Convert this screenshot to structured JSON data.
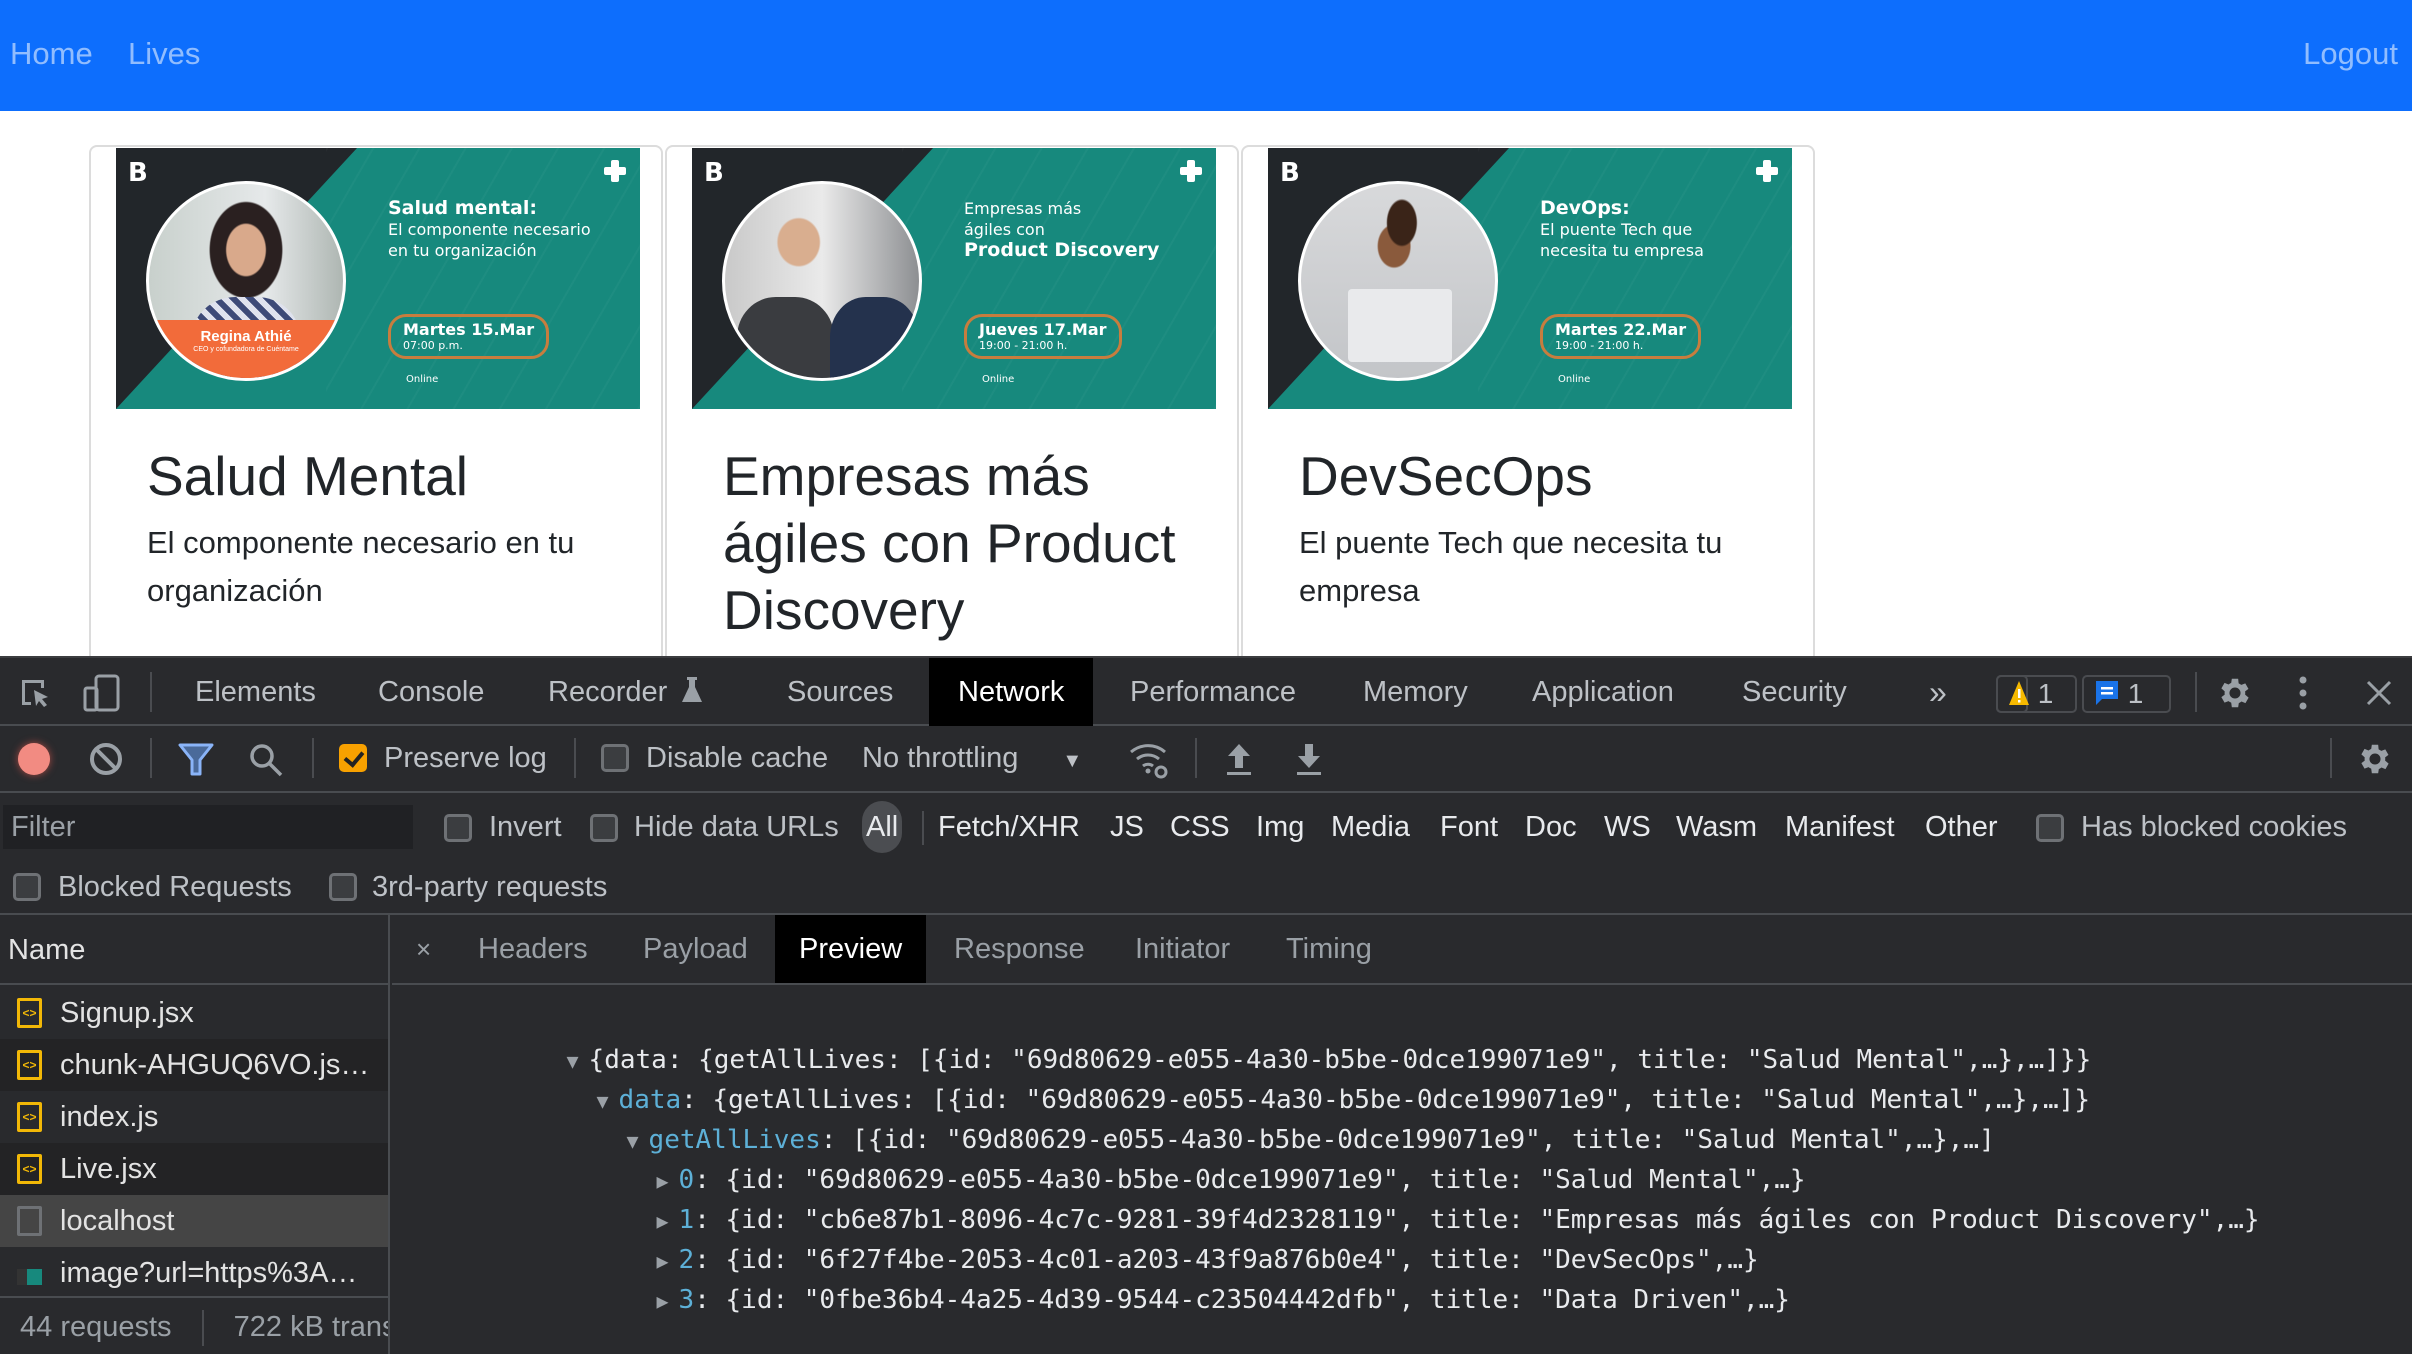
{
  "navbar": {
    "links": [
      "Home",
      "Lives"
    ],
    "logout": "Logout",
    "color": "#0d6efd"
  },
  "cards": [
    {
      "title": "Salud Mental",
      "description": "El componente necesario en tu organización",
      "image": {
        "headline_bold": "Salud mental:",
        "headline_rest": "El componente necesario en tu organización",
        "speaker_name": "Regina Athié",
        "speaker_role": "CEO y cofundadora de Cuéntame",
        "date": "Martes 15.Mar",
        "time": "07:00 p.m.",
        "mode": "Online"
      }
    },
    {
      "title": "Empresas más ágiles con Product Discovery",
      "description": "",
      "image": {
        "headline_pre": "Empresas más ágiles con",
        "headline_bold": "Product Discovery",
        "date": "Jueves 17.Mar",
        "time": "19:00 - 21:00 h.",
        "mode": "Online"
      }
    },
    {
      "title": "DevSecOps",
      "description": "El puente Tech que necesita tu empresa",
      "image": {
        "headline_bold": "DevOps:",
        "headline_rest": "El puente Tech que necesita tu empresa",
        "date": "Martes 22.Mar",
        "time": "19:00 - 21:00 h.",
        "mode": "Online"
      }
    }
  ],
  "devtools": {
    "tabs": [
      "Elements",
      "Console",
      "Recorder",
      "Sources",
      "Network",
      "Performance",
      "Memory",
      "Application",
      "Security"
    ],
    "active_tab": "Network",
    "more_tabs": "»",
    "warnings_count": "1",
    "messages_count": "1",
    "toolbar": {
      "preserve_log": {
        "label": "Preserve log",
        "checked": true
      },
      "disable_cache": {
        "label": "Disable cache",
        "checked": false
      },
      "throttling": "No throttling"
    },
    "filter": {
      "placeholder": "Filter",
      "invert": {
        "label": "Invert",
        "checked": false
      },
      "hide_data_urls": {
        "label": "Hide data URLs",
        "checked": false
      },
      "types": [
        "All",
        "Fetch/XHR",
        "JS",
        "CSS",
        "Img",
        "Media",
        "Font",
        "Doc",
        "WS",
        "Wasm",
        "Manifest",
        "Other"
      ],
      "active_type": "All",
      "has_blocked_cookies": {
        "label": "Has blocked cookies",
        "checked": false
      },
      "blocked_requests": {
        "label": "Blocked Requests",
        "checked": false
      },
      "third_party": {
        "label": "3rd-party requests",
        "checked": false
      }
    },
    "requests": {
      "header": "Name",
      "items": [
        {
          "name": "Signup.jsx",
          "type": "script"
        },
        {
          "name": "chunk-AHGUQ6VO.js…",
          "type": "script"
        },
        {
          "name": "index.js",
          "type": "script"
        },
        {
          "name": "Live.jsx",
          "type": "script"
        },
        {
          "name": "localhost",
          "type": "document",
          "selected": true
        },
        {
          "name": "image?url=https%3A…",
          "type": "image"
        }
      ],
      "summary_count": "44 requests",
      "summary_transfer": "722 kB trans"
    },
    "preview": {
      "close": "×",
      "tabs": [
        "Headers",
        "Payload",
        "Preview",
        "Response",
        "Initiator",
        "Timing"
      ],
      "active_tab": "Preview",
      "lines": [
        {
          "toggle": "▼",
          "key": "",
          "text": "{data: {getAllLives: [{id: \"69d80629-e055-4a30-b5be-0dce199071e9\", title: \"Salud Mental\",…},…]}}"
        },
        {
          "toggle": "▼",
          "key": "data",
          "text": ": {getAllLives: [{id: \"69d80629-e055-4a30-b5be-0dce199071e9\", title: \"Salud Mental\",…},…]}"
        },
        {
          "toggle": "▼",
          "key": "getAllLives",
          "text": ": [{id: \"69d80629-e055-4a30-b5be-0dce199071e9\", title: \"Salud Mental\",…},…]"
        },
        {
          "toggle": "▶",
          "key": "0",
          "text": ": {id: \"69d80629-e055-4a30-b5be-0dce199071e9\", title: \"Salud Mental\",…}"
        },
        {
          "toggle": "▶",
          "key": "1",
          "text": ": {id: \"cb6e87b1-8096-4c7c-9281-39f4d2328119\", title: \"Empresas más ágiles con Product Discovery\",…}"
        },
        {
          "toggle": "▶",
          "key": "2",
          "text": ": {id: \"6f27f4be-2053-4c01-a203-43f9a876b0e4\", title: \"DevSecOps\",…}"
        },
        {
          "toggle": "▶",
          "key": "3",
          "text": ": {id: \"0fbe36b4-4a25-4d39-9544-c23504442dfb\", title: \"Data Driven\",…}"
        }
      ]
    }
  }
}
